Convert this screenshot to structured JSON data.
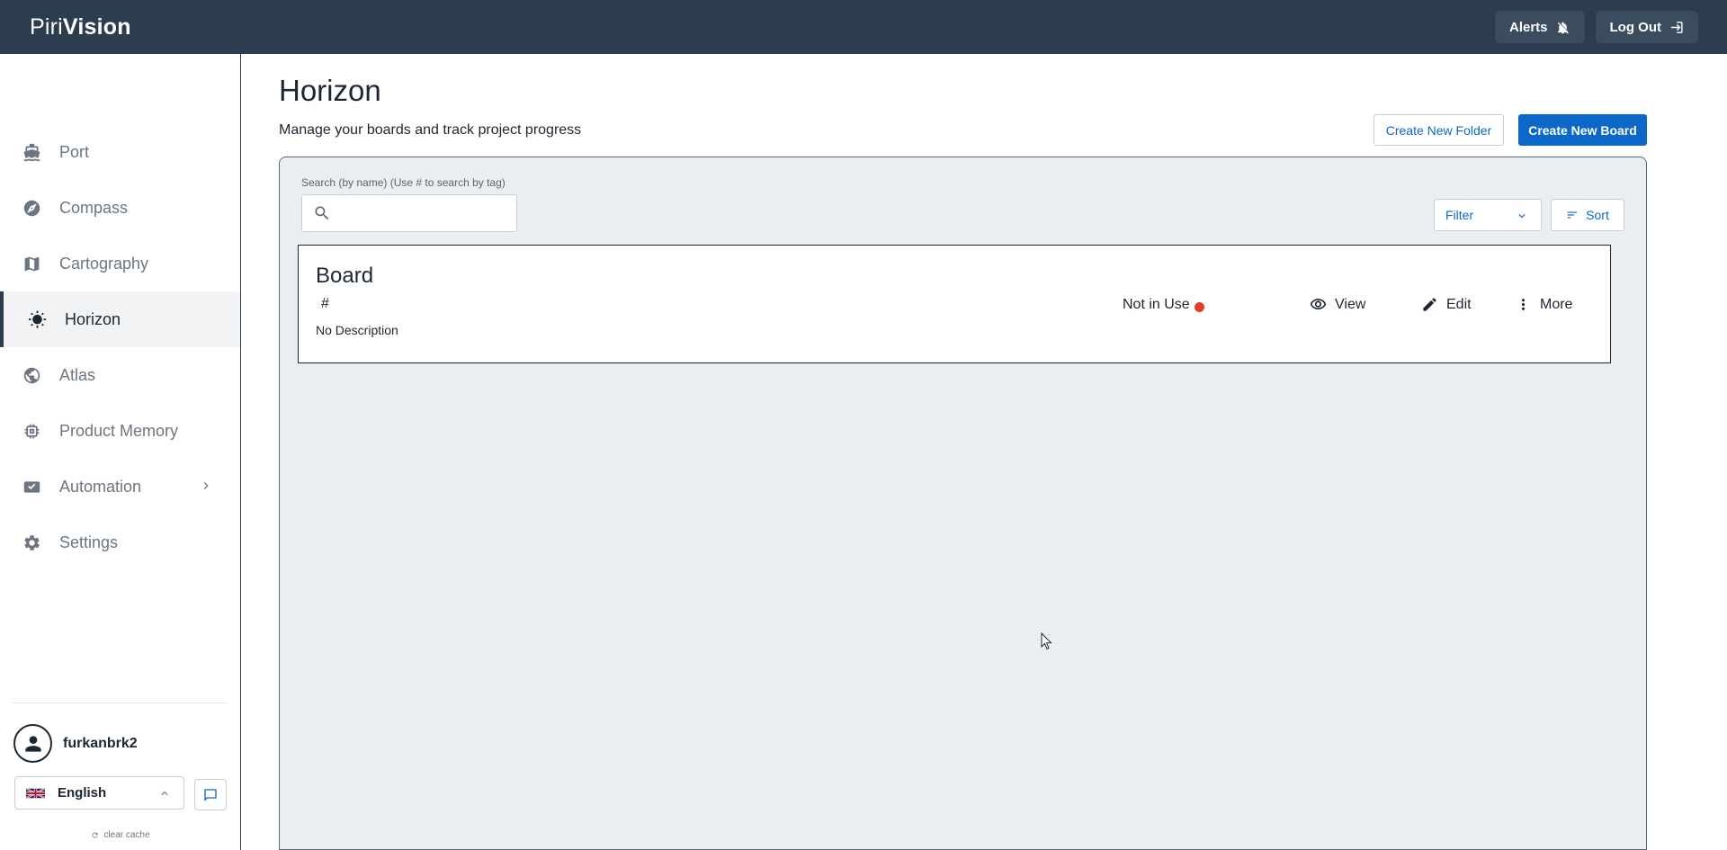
{
  "topbar": {
    "logo_part1": "Piri",
    "logo_part2": "Vision",
    "alerts_label": "Alerts",
    "logout_label": "Log Out"
  },
  "sidebar": {
    "items": [
      {
        "label": "Port",
        "icon": "ship-icon"
      },
      {
        "label": "Compass",
        "icon": "compass-icon"
      },
      {
        "label": "Cartography",
        "icon": "map-icon"
      },
      {
        "label": "Horizon",
        "icon": "sun-icon",
        "active": true
      },
      {
        "label": "Atlas",
        "icon": "globe-icon"
      },
      {
        "label": "Product Memory",
        "icon": "chip-icon"
      },
      {
        "label": "Automation",
        "icon": "automation-icon",
        "has_submenu": true
      },
      {
        "label": "Settings",
        "icon": "gear-icon"
      }
    ],
    "username": "furkanbrk2",
    "language": "English",
    "clear_cache": "clear cache"
  },
  "main": {
    "title": "Horizon",
    "subtitle": "Manage your boards and track project progress",
    "create_folder_label": "Create New Folder",
    "create_board_label": "Create New Board",
    "search_label": "Search (by name)  (Use # to search by tag)",
    "search_value": "",
    "filter_label": "Filter",
    "sort_label": "Sort",
    "boards": [
      {
        "title": "Board",
        "tag": "#",
        "description": "No Description",
        "status": "Not in Use",
        "status_color": "#e23c2a",
        "view_label": "View",
        "edit_label": "Edit",
        "more_label": "More"
      }
    ]
  },
  "colors": {
    "topbar": "#2d3d50",
    "accent": "#0c68c8",
    "panel_bg": "#ebeef0"
  }
}
